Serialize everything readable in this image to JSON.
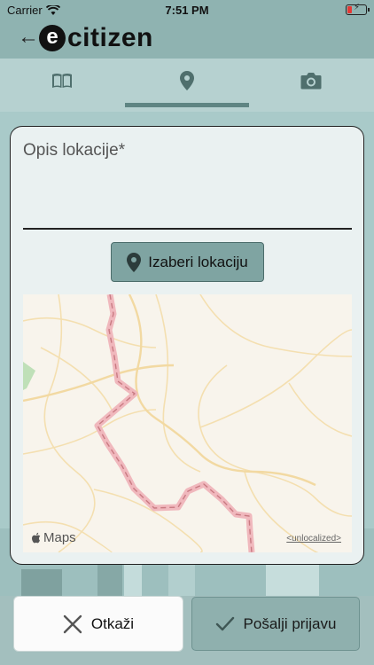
{
  "status_bar": {
    "carrier": "Carrier",
    "time": "7:51 PM"
  },
  "header": {
    "logo_letter": "e",
    "logo_text": "citizen"
  },
  "tabs": [
    {
      "icon": "book-icon"
    },
    {
      "icon": "location-pin-icon"
    },
    {
      "icon": "camera-icon"
    }
  ],
  "form": {
    "location_label": "Opis lokacije*",
    "location_value": "",
    "choose_location_label": "Izaberi lokaciju"
  },
  "map": {
    "brand": "Maps",
    "legal_link": "<unlocalized>"
  },
  "actions": {
    "cancel_label": "Otkaži",
    "submit_label": "Pošalji prijavu"
  },
  "colors": {
    "header_bg": "#8fb3b1",
    "tabbar_bg": "#b6d1d0",
    "accent": "#7fa4a2",
    "card_bg": "#eaf1f1"
  }
}
